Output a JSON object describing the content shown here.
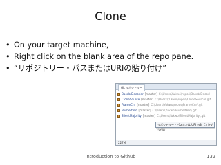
{
  "slide": {
    "title": "Clone",
    "bullets": [
      "On your target machine,",
      "Right click on the blank area of the repo pane.",
      "“リポジトリー・パスまたはURIの貼り付け”"
    ],
    "bullet_glyph": "•"
  },
  "screenshot": {
    "tabs": [
      "Git リポジトリー"
    ],
    "repos": [
      {
        "name": "BasebIDecoder",
        "branch": "[master]",
        "path": "C:\\Users\\Yukwo\\repos\\BasebIDecod"
      },
      {
        "name": "CloneSource",
        "branch": "[master]",
        "path": "C:\\Users\\Yukwo\\repos\\CloneSource\\.git"
      },
      {
        "name": "FrameCnr",
        "branch": "[master]",
        "path": "C:\\Users\\Yukwo\\repos\\FrameCnr\\.git"
      },
      {
        "name": "PushertPro",
        "branch": "[master]",
        "path": "C:\\Users\\Yukwo\\PushertPro\\.git"
      },
      {
        "name": "SilentMajority",
        "branch": "[master]",
        "path": "C:\\Users\\Yukwo\\SilentMajority\\.git"
      }
    ],
    "context_menu": {
      "item": "リポジトリー・パスまたは URI の貼り付け",
      "shortcut": "Ctrl+V"
    },
    "status": "227M"
  },
  "footer": {
    "text": "Introduction to Github",
    "page_number": "132"
  }
}
